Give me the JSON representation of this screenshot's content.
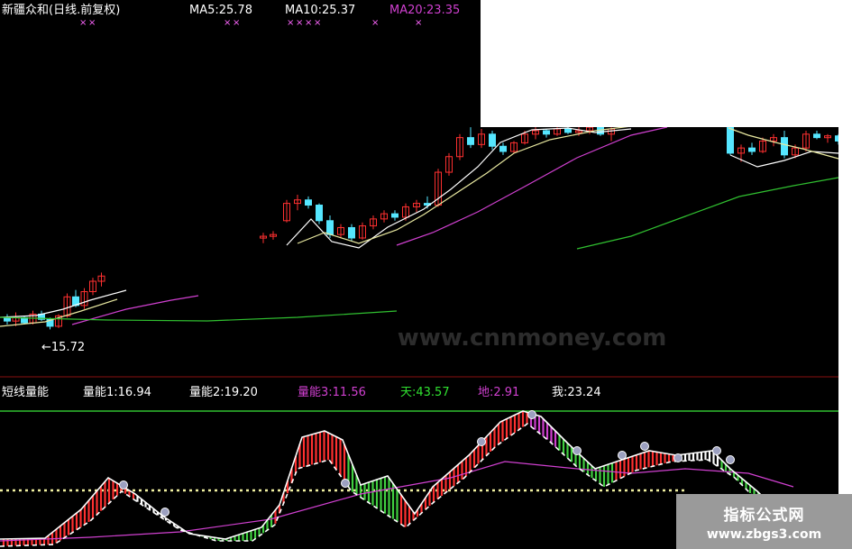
{
  "upper_panel": {
    "title": "新疆众和(日线.前复权)",
    "ma5_label": "MA5:25.78",
    "ma10_label": "MA10:25.37",
    "ma20_label": "MA20:23.35",
    "low_marker": "←15.72",
    "watermark": "www.cnnmoney.com"
  },
  "lower_panel": {
    "title": "短线量能",
    "label1": "量能1:16.94",
    "label2": "量能2:19.20",
    "label3": "量能3:11.56",
    "label4": "天:43.57",
    "label5": "地:2.91",
    "label6": "我:23.24"
  },
  "logo": {
    "line1": "指标公式网",
    "line2": "www.zbgs3.com"
  },
  "colors": {
    "bg": "#000000",
    "up": "#ff3030",
    "down": "#55e6ff",
    "ma5": "#ffffff",
    "ma10": "#e8e8a0",
    "ma20": "#d040d0",
    "ma60": "#30c030",
    "white_text": "#ffffff",
    "magenta_text": "#d040d0",
    "green_text": "#30e030",
    "red_text": "#ff3030"
  },
  "chart_data": [
    {
      "type": "candlestick",
      "title": "新疆众和(日线.前复权)",
      "series": [
        {
          "name": "MA5",
          "value": 25.78
        },
        {
          "name": "MA10",
          "value": 25.37
        },
        {
          "name": "MA20",
          "value": 23.35
        }
      ],
      "annotations": [
        "15.72"
      ],
      "ohlc": [
        [
          16.4,
          16.6,
          16.0,
          16.2
        ],
        [
          16.2,
          16.7,
          15.9,
          16.4
        ],
        [
          16.4,
          16.5,
          16.0,
          16.1
        ],
        [
          16.1,
          16.8,
          16.0,
          16.6
        ],
        [
          16.6,
          16.8,
          16.2,
          16.3
        ],
        [
          16.3,
          16.4,
          15.72,
          15.9
        ],
        [
          15.9,
          16.6,
          15.8,
          16.5
        ],
        [
          16.5,
          17.8,
          16.4,
          17.6
        ],
        [
          17.6,
          18.0,
          17.0,
          17.1
        ],
        [
          17.1,
          18.1,
          16.9,
          17.9
        ],
        [
          17.9,
          18.7,
          17.7,
          18.5
        ],
        [
          18.5,
          19.0,
          18.2,
          18.8
        ],
        [
          21.0,
          21.3,
          20.7,
          21.1
        ],
        [
          21.1,
          21.4,
          20.9,
          21.2
        ],
        [
          22.0,
          23.2,
          21.9,
          23.0
        ],
        [
          23.0,
          23.5,
          22.6,
          23.2
        ],
        [
          23.2,
          23.4,
          22.7,
          22.9
        ],
        [
          22.9,
          23.0,
          21.8,
          22.0
        ],
        [
          22.0,
          22.3,
          21.0,
          21.2
        ],
        [
          21.2,
          21.8,
          21.0,
          21.6
        ],
        [
          21.6,
          21.8,
          20.8,
          21.0
        ],
        [
          21.0,
          21.9,
          20.9,
          21.7
        ],
        [
          21.7,
          22.3,
          21.5,
          22.1
        ],
        [
          22.1,
          22.6,
          21.9,
          22.4
        ],
        [
          22.4,
          22.6,
          22.0,
          22.2
        ],
        [
          22.2,
          23.0,
          22.0,
          22.8
        ],
        [
          22.8,
          23.2,
          22.5,
          23.0
        ],
        [
          23.0,
          23.4,
          22.7,
          22.9
        ],
        [
          22.9,
          25.0,
          22.8,
          24.8
        ],
        [
          24.8,
          25.9,
          24.6,
          25.7
        ],
        [
          25.7,
          27.0,
          25.5,
          26.8
        ],
        [
          26.8,
          27.4,
          26.2,
          26.4
        ],
        [
          26.4,
          27.3,
          26.2,
          27.0
        ],
        [
          27.0,
          27.2,
          26.1,
          26.3
        ],
        [
          26.3,
          26.5,
          25.8,
          26.0
        ],
        [
          26.0,
          26.6,
          25.9,
          26.5
        ],
        [
          26.5,
          27.2,
          26.4,
          27.0
        ],
        [
          27.0,
          27.4,
          26.7,
          27.2
        ],
        [
          27.2,
          27.3,
          26.8,
          27.0
        ],
        [
          27.0,
          27.4,
          26.9,
          27.3
        ],
        [
          27.3,
          27.5,
          27.0,
          27.1
        ],
        [
          27.1,
          27.4,
          26.9,
          27.2
        ],
        [
          27.2,
          27.5,
          27.0,
          27.4
        ],
        [
          27.4,
          27.6,
          26.9,
          27.0
        ],
        [
          27.0,
          27.4,
          26.6,
          27.3
        ],
        [
          27.6,
          27.7,
          25.8,
          25.9
        ],
        [
          25.9,
          26.4,
          25.4,
          26.2
        ],
        [
          26.2,
          26.5,
          25.8,
          26.0
        ],
        [
          26.0,
          26.8,
          25.9,
          26.6
        ],
        [
          26.6,
          27.0,
          26.3,
          26.8
        ],
        [
          26.8,
          27.2,
          25.6,
          25.8
        ],
        [
          25.8,
          26.4,
          25.6,
          26.2
        ],
        [
          26.2,
          27.2,
          26.0,
          27.0
        ],
        [
          27.0,
          27.2,
          26.7,
          26.8
        ],
        [
          26.8,
          27.0,
          26.5,
          26.9
        ],
        [
          26.9,
          27.0,
          26.4,
          26.6
        ]
      ]
    },
    {
      "type": "line",
      "title": "短线量能",
      "series": [
        {
          "name": "量能1",
          "value": 16.94
        },
        {
          "name": "量能2",
          "value": 19.2
        },
        {
          "name": "量能3",
          "value": 11.56
        },
        {
          "name": "天",
          "value": 43.57
        },
        {
          "name": "地",
          "value": 2.91
        },
        {
          "name": "我",
          "value": 23.24
        }
      ]
    }
  ]
}
